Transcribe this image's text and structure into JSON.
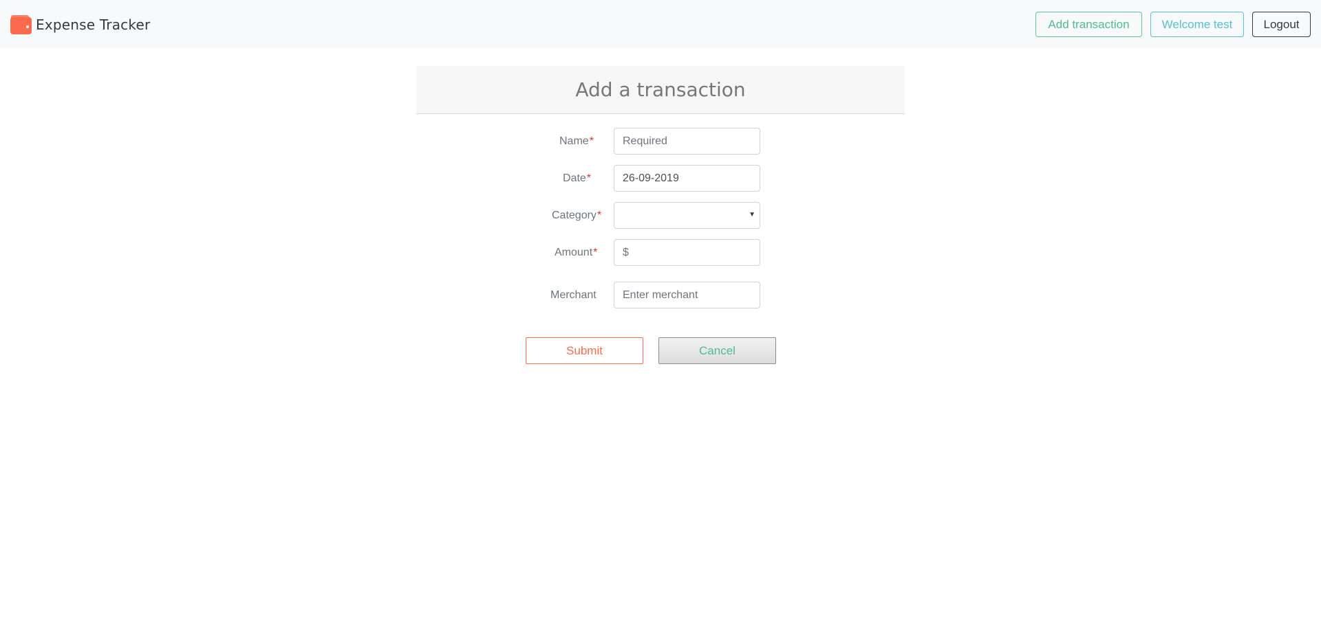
{
  "app": {
    "brand": "Expense Tracker",
    "brand_icon": "wallet-icon",
    "accent_color": "#fb6a4a"
  },
  "nav": {
    "add_transaction_label": "Add transaction",
    "welcome_label": "Welcome test",
    "logout_label": "Logout"
  },
  "form": {
    "title": "Add a transaction",
    "required_marker": "*",
    "fields": {
      "name": {
        "label": "Name",
        "placeholder": "Required",
        "value": ""
      },
      "date": {
        "label": "Date",
        "value": "26-09-2019"
      },
      "category": {
        "label": "Category",
        "value": ""
      },
      "amount": {
        "label": "Amount",
        "placeholder": "$",
        "value": ""
      },
      "merchant": {
        "label": "Merchant",
        "placeholder": "Enter merchant",
        "value": ""
      }
    },
    "submit_label": "Submit",
    "cancel_label": "Cancel"
  }
}
